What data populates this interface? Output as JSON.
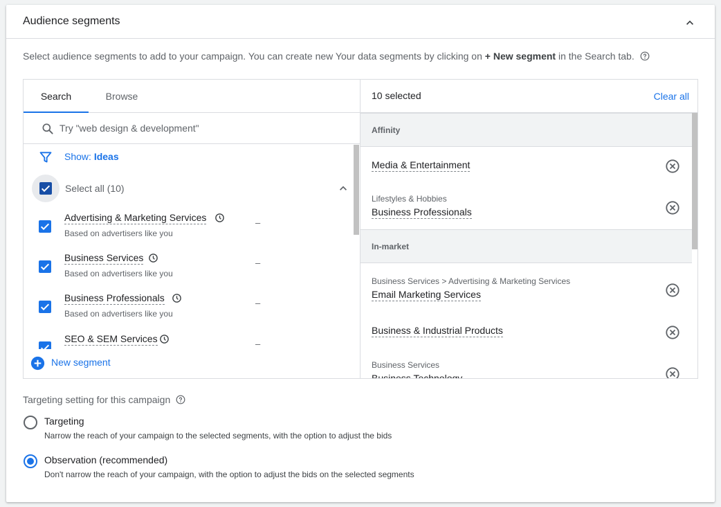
{
  "header": {
    "title": "Audience segments"
  },
  "description": {
    "prefix": "Select audience segments to add to your campaign. You can create new Your data segments by clicking on ",
    "bold": "+ New segment",
    "suffix": " in the Search tab."
  },
  "tabs": [
    {
      "label": "Search",
      "active": true
    },
    {
      "label": "Browse",
      "active": false
    }
  ],
  "search": {
    "placeholder": "Try \"web design & development\""
  },
  "filter": {
    "prefix": "Show: ",
    "value": "Ideas"
  },
  "select_all": {
    "label": "Select all (10)",
    "checked": true
  },
  "segments": [
    {
      "name": "Advertising & Marketing Services",
      "sub": "Based on advertisers like you",
      "dash": "–",
      "checked": true
    },
    {
      "name": "Business Services",
      "sub": "Based on advertisers like you",
      "dash": "–",
      "checked": true
    },
    {
      "name": "Business Professionals",
      "sub": "Based on advertisers like you",
      "dash": "–",
      "checked": true
    },
    {
      "name": "SEO & SEM Services",
      "sub": "",
      "dash": "–",
      "checked": true
    }
  ],
  "new_segment": {
    "label": "New segment"
  },
  "selected_panel": {
    "count_label": "10 selected",
    "clear_label": "Clear all",
    "groups": [
      {
        "title": "Affinity",
        "items": [
          {
            "parent": "",
            "name": "Media & Entertainment"
          },
          {
            "parent": "Lifestyles & Hobbies",
            "name": "Business Professionals"
          }
        ]
      },
      {
        "title": "In-market",
        "items": [
          {
            "parent": "Business Services > Advertising & Marketing Services",
            "name": "Email Marketing Services"
          },
          {
            "parent": "",
            "name": "Business & Industrial Products"
          },
          {
            "parent": "Business Services",
            "name": "Business Technology"
          }
        ]
      }
    ]
  },
  "targeting": {
    "title": "Targeting setting for this campaign",
    "options": [
      {
        "label": "Targeting",
        "desc": "Narrow the reach of your campaign to the selected segments, with the option to adjust the bids",
        "checked": false
      },
      {
        "label": "Observation (recommended)",
        "desc": "Don't narrow the reach of your campaign, with the option to adjust the bids on the selected segments",
        "checked": true
      }
    ]
  },
  "colors": {
    "accent": "#1a73e8",
    "checkbox_dark": "#174ea6",
    "text": "#202124",
    "muted": "#5f6368",
    "border": "#dadce0"
  }
}
